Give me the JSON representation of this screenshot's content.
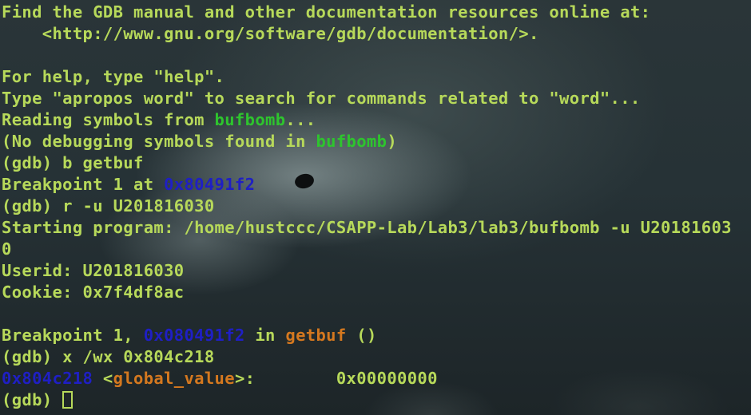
{
  "terminal": {
    "lines": [
      {
        "segments": [
          {
            "text": "Find the GDB manual and other documentation resources online at:"
          }
        ]
      },
      {
        "segments": [
          {
            "text": "    <http://www.gnu.org/software/gdb/documentation/>."
          }
        ]
      },
      {
        "segments": [
          {
            "text": ""
          }
        ]
      },
      {
        "segments": [
          {
            "text": "For help, type \"help\"."
          }
        ]
      },
      {
        "segments": [
          {
            "text": "Type \"apropos word\" to search for commands related to \"word\"..."
          }
        ]
      },
      {
        "segments": [
          {
            "text": "Reading symbols from "
          },
          {
            "text": "bufbomb",
            "color": "green"
          },
          {
            "text": "..."
          }
        ]
      },
      {
        "segments": [
          {
            "text": "(No debugging symbols found in "
          },
          {
            "text": "bufbomb",
            "color": "green"
          },
          {
            "text": ")"
          }
        ]
      },
      {
        "segments": [
          {
            "text": "(gdb) b getbuf"
          }
        ]
      },
      {
        "segments": [
          {
            "text": "Breakpoint 1 at "
          },
          {
            "text": "0x80491f2",
            "color": "blue"
          }
        ]
      },
      {
        "segments": [
          {
            "text": "(gdb) r -u U201816030"
          }
        ]
      },
      {
        "segments": [
          {
            "text": "Starting program: /home/hustccc/CSAPP-Lab/Lab3/lab3/bufbomb -u U20181603"
          }
        ]
      },
      {
        "segments": [
          {
            "text": "0"
          }
        ]
      },
      {
        "segments": [
          {
            "text": "Userid: U201816030"
          }
        ]
      },
      {
        "segments": [
          {
            "text": "Cookie: 0x7f4df8ac"
          }
        ]
      },
      {
        "segments": [
          {
            "text": ""
          }
        ]
      },
      {
        "segments": [
          {
            "text": "Breakpoint 1, "
          },
          {
            "text": "0x080491f2",
            "color": "blue"
          },
          {
            "text": " in "
          },
          {
            "text": "getbuf",
            "color": "orange"
          },
          {
            "text": " ()"
          }
        ]
      },
      {
        "segments": [
          {
            "text": "(gdb) x /wx 0x804c218"
          }
        ]
      },
      {
        "segments": [
          {
            "text": "0x804c218",
            "color": "blue"
          },
          {
            "text": " <"
          },
          {
            "text": "global_value",
            "color": "orange"
          },
          {
            "text": ">:        0x00000000"
          }
        ]
      },
      {
        "segments": [
          {
            "text": "(gdb) "
          }
        ],
        "cursor": true
      }
    ]
  },
  "colors": {
    "default_text": "#b7d95a",
    "green": "#2ec42e",
    "blue": "#1f1fc4",
    "orange": "#d4781f"
  }
}
